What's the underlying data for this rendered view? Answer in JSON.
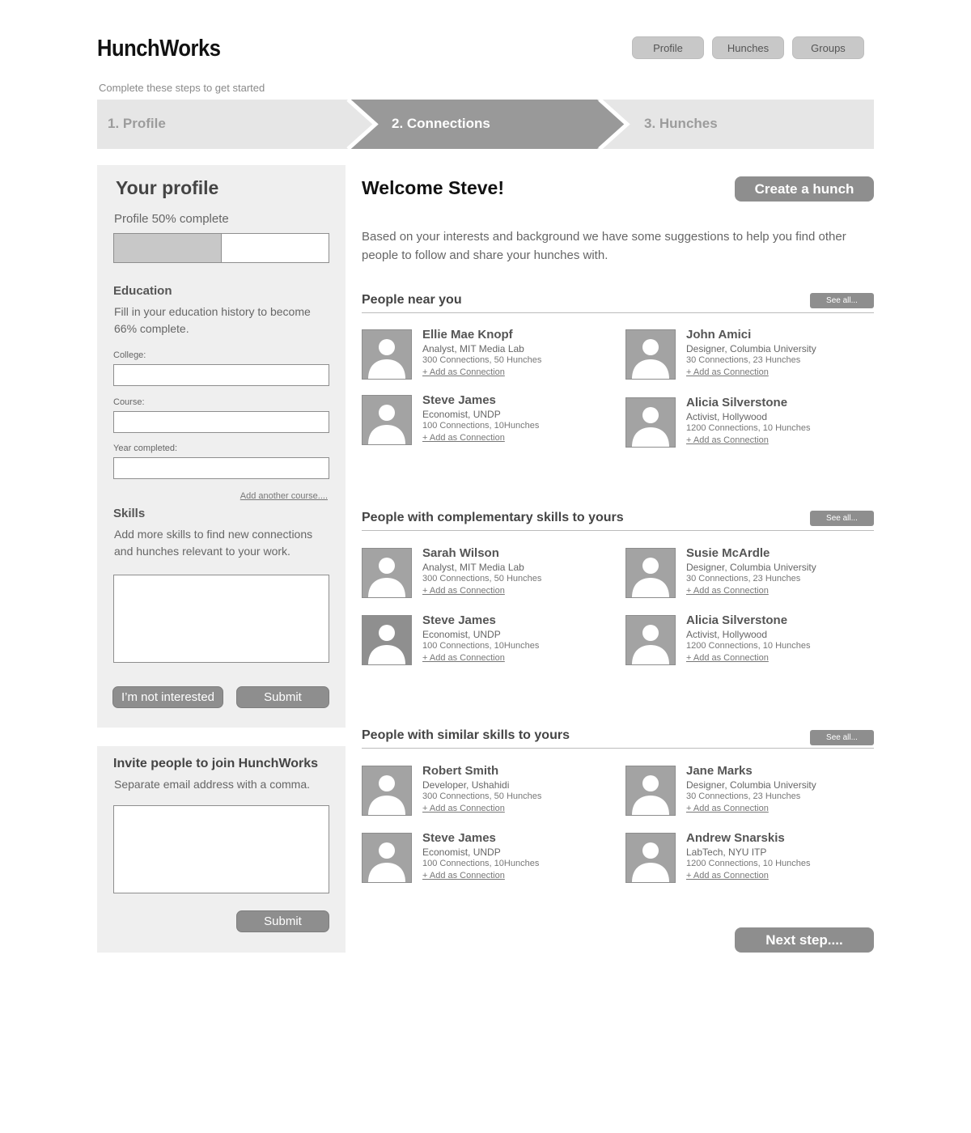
{
  "app": {
    "logo": "HunchWorks"
  },
  "topnav": {
    "items": [
      "Profile",
      "Hunches",
      "Groups"
    ]
  },
  "steps": {
    "caption": "Complete these steps to get started",
    "items": [
      "1. Profile",
      "2. Connections",
      "3. Hunches"
    ],
    "active_index": 1
  },
  "profile_panel": {
    "title": "Your profile",
    "completion_text": "Profile 50% complete",
    "completion_fraction": 0.5,
    "education": {
      "title": "Education",
      "description": "Fill in your education history to become 66% complete.",
      "college_label": "College:",
      "college_value": "",
      "course_label": "Course:",
      "course_value": "",
      "year_label": "Year completed:",
      "year_value": "",
      "add_course_link": "Add another course...."
    },
    "skills": {
      "title": "Skills",
      "description": "Add more skills to find new connections and hunches relevant to your work.",
      "value": ""
    },
    "not_interested_label": "I’m not interested",
    "submit_label": "Submit"
  },
  "invite_panel": {
    "title": "Invite people to join HunchWorks",
    "description": "Separate email address with a comma.",
    "value": "",
    "submit_label": "Submit"
  },
  "main": {
    "welcome": "Welcome Steve!",
    "create_hunch_label": "Create a hunch",
    "intro": "Based on your interests and background we have some suggestions to help you find other people to follow and share your hunches with.",
    "next_step_label": "Next step....",
    "sections": [
      {
        "title": "People near you",
        "see_all": "See all...",
        "people": [
          {
            "name": "Ellie Mae Knopf",
            "role": "Analyst, MIT Media Lab",
            "stats": "300 Connections, 50 Hunches",
            "add": "+ Add as Connection"
          },
          {
            "name": "John Amici",
            "role": "Designer, Columbia University",
            "stats": "30 Connections, 23 Hunches",
            "add": "+ Add as Connection"
          },
          {
            "name": "Steve James",
            "role": "Economist, UNDP",
            "stats": "100 Connections, 10Hunches",
            "add": "+ Add as Connection"
          },
          {
            "name": "Alicia Silverstone",
            "role": "Activist, Hollywood",
            "stats": "1200 Connections, 10 Hunches",
            "add": "+ Add as Connection"
          }
        ]
      },
      {
        "title": "People with complementary skills to yours",
        "see_all": "See all...",
        "people": [
          {
            "name": "Sarah Wilson",
            "role": "Analyst, MIT Media Lab",
            "stats": "300 Connections, 50 Hunches",
            "add": "+ Add as Connection"
          },
          {
            "name": "Susie McArdle",
            "role": "Designer, Columbia University",
            "stats": "30 Connections, 23 Hunches",
            "add": "+ Add as Connection"
          },
          {
            "name": "Steve James",
            "role": "Economist, UNDP",
            "stats": "100 Connections, 10Hunches",
            "add": "+ Add as Connection"
          },
          {
            "name": "Alicia Silverstone",
            "role": "Activist, Hollywood",
            "stats": "1200 Connections, 10 Hunches",
            "add": "+ Add as Connection"
          }
        ]
      },
      {
        "title": "People with similar skills to yours",
        "see_all": "See all...",
        "people": [
          {
            "name": "Robert Smith",
            "role": "Developer, Ushahidi",
            "stats": "300 Connections, 50 Hunches",
            "add": "+ Add as Connection"
          },
          {
            "name": "Jane Marks",
            "role": "Designer, Columbia University",
            "stats": "30 Connections, 23 Hunches",
            "add": "+ Add as Connection"
          },
          {
            "name": "Steve James",
            "role": "Economist, UNDP",
            "stats": "100 Connections, 10Hunches",
            "add": "+ Add as Connection"
          },
          {
            "name": "Andrew Snarskis",
            "role": "LabTech, NYU ITP",
            "stats": "1200 Connections, 10 Hunches",
            "add": "+ Add as Connection"
          }
        ]
      }
    ]
  },
  "colors": {
    "panel_bg": "#efefef",
    "accent_gray": "#8e8e8e",
    "step_active": "#999999",
    "step_inactive": "#e6e6e6"
  },
  "icons": {
    "avatar": "person-placeholder-icon"
  }
}
